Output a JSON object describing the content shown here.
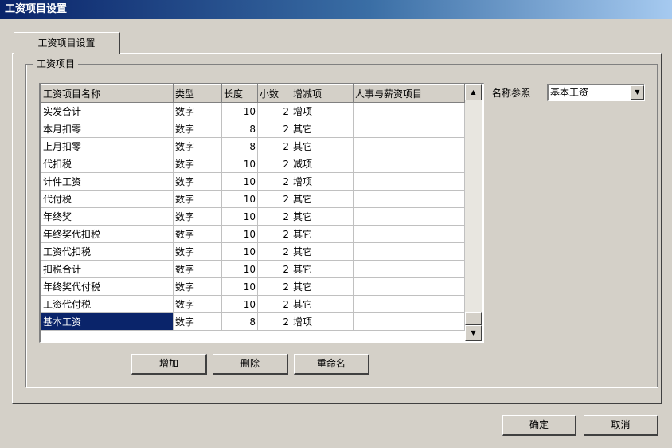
{
  "window": {
    "title": "工资项目设置"
  },
  "tab": {
    "label": "工资项目设置"
  },
  "group": {
    "label": "工资项目"
  },
  "table": {
    "headers": [
      "工资项目名称",
      "类型",
      "长度",
      "小数",
      "增减项",
      "人事与薪资项目"
    ],
    "rows": [
      [
        "实发合计",
        "数字",
        "10",
        "2",
        "增项",
        ""
      ],
      [
        "本月扣零",
        "数字",
        "8",
        "2",
        "其它",
        ""
      ],
      [
        "上月扣零",
        "数字",
        "8",
        "2",
        "其它",
        ""
      ],
      [
        "代扣税",
        "数字",
        "10",
        "2",
        "减项",
        ""
      ],
      [
        "计件工资",
        "数字",
        "10",
        "2",
        "增项",
        ""
      ],
      [
        "代付税",
        "数字",
        "10",
        "2",
        "其它",
        ""
      ],
      [
        "年终奖",
        "数字",
        "10",
        "2",
        "其它",
        ""
      ],
      [
        "年终奖代扣税",
        "数字",
        "10",
        "2",
        "其它",
        ""
      ],
      [
        "工资代扣税",
        "数字",
        "10",
        "2",
        "其它",
        ""
      ],
      [
        "扣税合计",
        "数字",
        "10",
        "2",
        "其它",
        ""
      ],
      [
        "年终奖代付税",
        "数字",
        "10",
        "2",
        "其它",
        ""
      ],
      [
        "工资代付税",
        "数字",
        "10",
        "2",
        "其它",
        ""
      ],
      [
        "基本工资",
        "数字",
        "8",
        "2",
        "增项",
        ""
      ]
    ],
    "selected_row": 12
  },
  "scrollbar": {
    "up_icon": "arrow-up-icon",
    "down_icon": "arrow-down-icon"
  },
  "buttons": {
    "add": "增加",
    "delete": "删除",
    "rename": "重命名",
    "ok": "确定",
    "cancel": "取消"
  },
  "reference": {
    "label": "名称参照",
    "value": "基本工资",
    "dropdown_icon": "chevron-down-icon"
  }
}
